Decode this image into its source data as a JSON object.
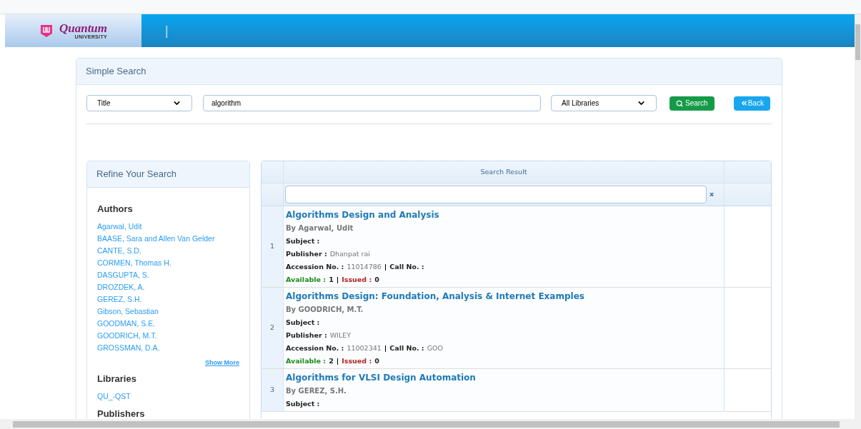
{
  "logo": {
    "name": "Quantum",
    "sub": "UNIVERSITY"
  },
  "header_divider": "|",
  "panel": {
    "title": "Simple Search"
  },
  "search": {
    "field": "Title",
    "query": "algorithm",
    "library": "All Libraries",
    "search_button": "Search",
    "back_button": "Back"
  },
  "refine": {
    "title": "Refine Your Search",
    "sections": [
      {
        "title": "Authors",
        "items": [
          "Agarwal, Udit",
          "BAASE, Sara and Allen Van Gelder",
          "CANTE, S.D.",
          "CORMEN, Thomas H.",
          "DASGUPTA, S.",
          "DROZDEK, A.",
          "GEREZ, S.H.",
          "Gibson, Sebastian",
          "GOODMAN, S.E.",
          "GOODRICH, M.T.",
          "GROSSMAN, D.A."
        ],
        "more": "Show More"
      },
      {
        "title": "Libraries",
        "items": [
          "QU_-QST"
        ]
      },
      {
        "title": "Publishers"
      }
    ]
  },
  "results": {
    "title": "Search Result",
    "clear": "x",
    "rows": [
      {
        "index": "1",
        "title": "Algorithms Design and Analysis",
        "by": "By Agarwal, Udit",
        "subject_label": "Subject :",
        "publisher_label": "Publisher :",
        "publisher": "Dhanpat rai",
        "accession_label": "Accession No. :",
        "accession": "11014786",
        "call_label": "Call No. :",
        "call": "",
        "sep": "|",
        "available_label": "Available :",
        "available": "1",
        "issued_label": "Issued :",
        "issued": "0"
      },
      {
        "index": "2",
        "title": "Algorithms Design: Foundation, Analysis & Internet Examples",
        "by": "By GOODRICH, M.T.",
        "subject_label": "Subject :",
        "publisher_label": "Publisher :",
        "publisher": "WILEY",
        "accession_label": "Accession No. :",
        "accession": "11002341",
        "call_label": "Call No. :",
        "call": "GOO",
        "sep": "|",
        "available_label": "Available :",
        "available": "2",
        "issued_label": "Issued :",
        "issued": "0"
      },
      {
        "index": "3",
        "title": "Algorithms for VLSI Design Automation",
        "by": "By GEREZ, S.H.",
        "subject_label": "Subject :"
      }
    ]
  }
}
